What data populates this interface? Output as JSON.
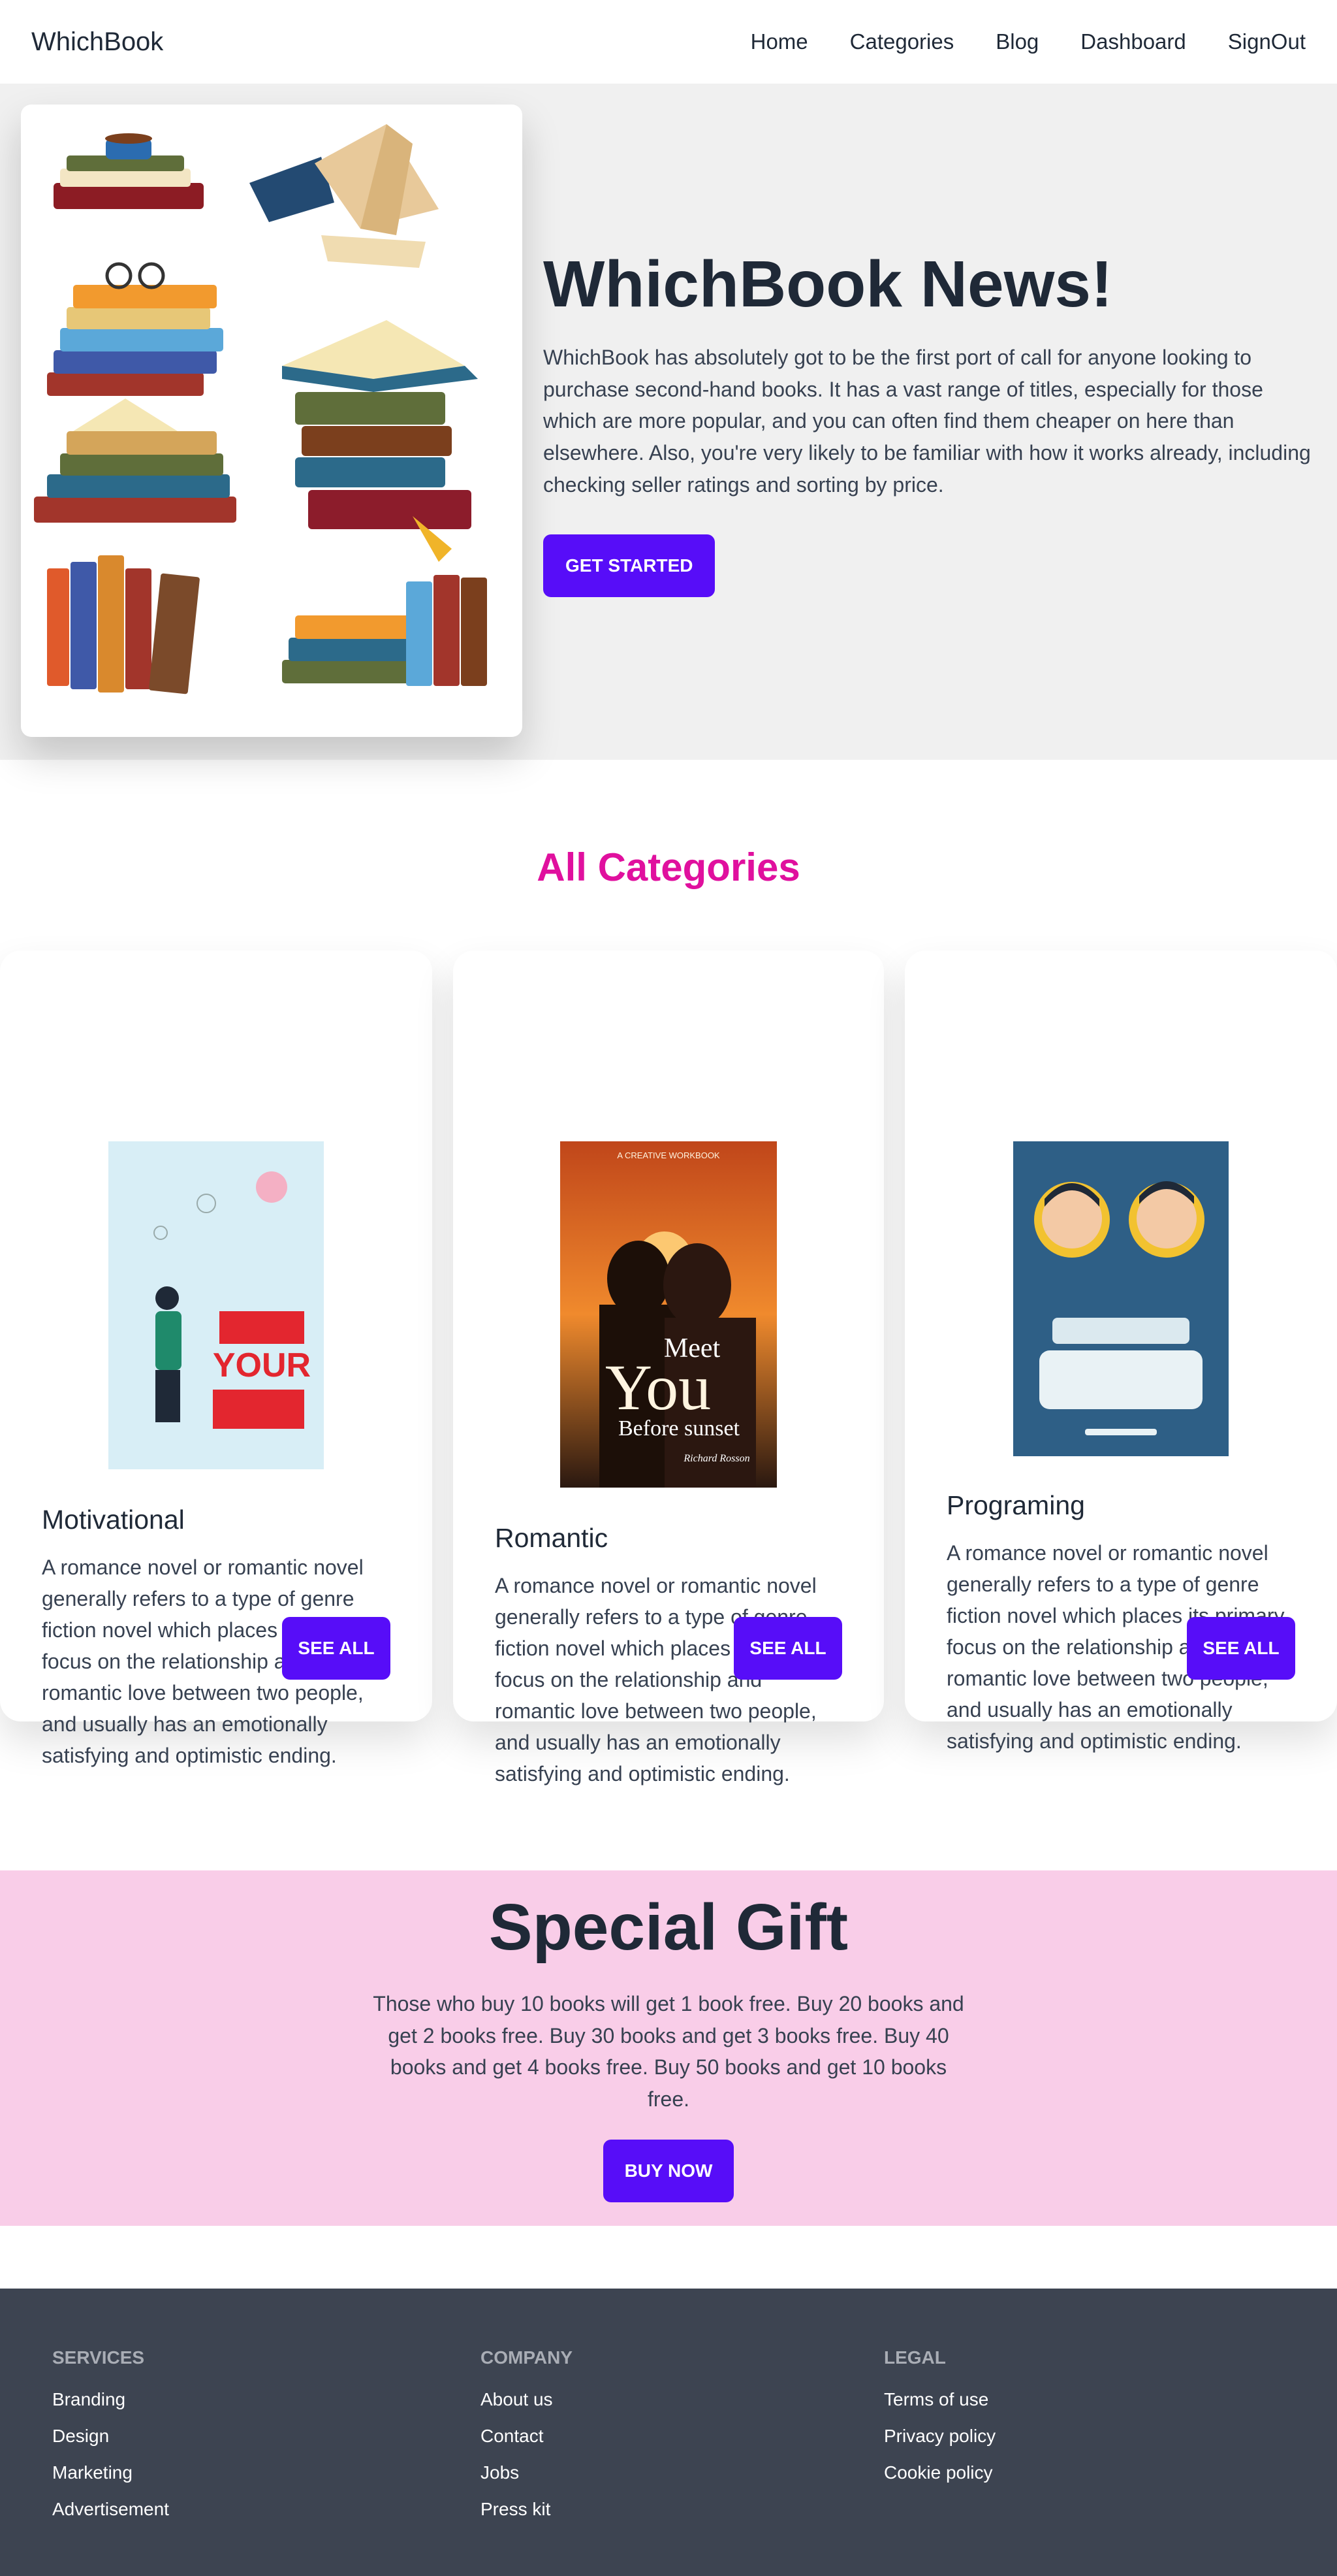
{
  "nav": {
    "brand": "WhichBook",
    "links": [
      "Home",
      "Categories",
      "Blog",
      "Dashboard",
      "SignOut"
    ]
  },
  "hero": {
    "title": "WhichBook News!",
    "description": "WhichBook has absolutely got to be the first port of call for anyone looking to purchase second-hand books. It has a vast range of titles, especially for those which are more popular, and you can often find them cheaper on here than elsewhere. Also, you're very likely to be familiar with how it works already, including checking seller ratings and sorting by price.",
    "cta": "GET STARTED",
    "image_icon": "book-stacks-illustration"
  },
  "categories": {
    "title": "All Categories",
    "cards": [
      {
        "name": "Motivational",
        "description": "A romance novel or romantic novel generally refers to a type of genre fiction novel which places its primary focus on the relationship and romantic love between two people, and usually has an emotionally satisfying and optimistic ending.",
        "button": "SEE ALL",
        "cover": {
          "text": "YOUR"
        }
      },
      {
        "name": "Romantic",
        "description": "A romance novel or romantic novel generally refers to a type of genre fiction novel which places its primary focus on the relationship and romantic love between two people, and usually has an emotionally satisfying and optimistic ending.",
        "button": "SEE ALL",
        "cover": {
          "top": "A CREATIVE WORKBOOK",
          "line1": "Meet",
          "line2": "You",
          "line3": "Before sunset",
          "author": "Richard Rosson"
        }
      },
      {
        "name": "Programing",
        "description": "A romance novel or romantic novel generally refers to a type of genre fiction novel which places its primary focus on the relationship and romantic love between two people, and usually has an emotionally satisfying and optimistic ending.",
        "button": "SEE ALL",
        "cover": {}
      }
    ]
  },
  "gift": {
    "title": "Special Gift",
    "description": "Those who buy 10 books will get 1 book free. Buy 20 books and get 2 books free. Buy 30 books and get 3 books free. Buy 40 books and get 4 books free. Buy 50 books and get 10 books free.",
    "cta": "BUY NOW"
  },
  "footer": {
    "columns": [
      {
        "title": "SERVICES",
        "links": [
          "Branding",
          "Design",
          "Marketing",
          "Advertisement"
        ]
      },
      {
        "title": "COMPANY",
        "links": [
          "About us",
          "Contact",
          "Jobs",
          "Press kit"
        ]
      },
      {
        "title": "LEGAL",
        "links": [
          "Terms of use",
          "Privacy policy",
          "Cookie policy"
        ]
      }
    ]
  },
  "colors": {
    "primary": "#570df8",
    "accent": "#e0109e",
    "gift_bg": "#f9cde8",
    "footer_bg": "#3d4451",
    "hero_bg": "#f0f0f0"
  }
}
